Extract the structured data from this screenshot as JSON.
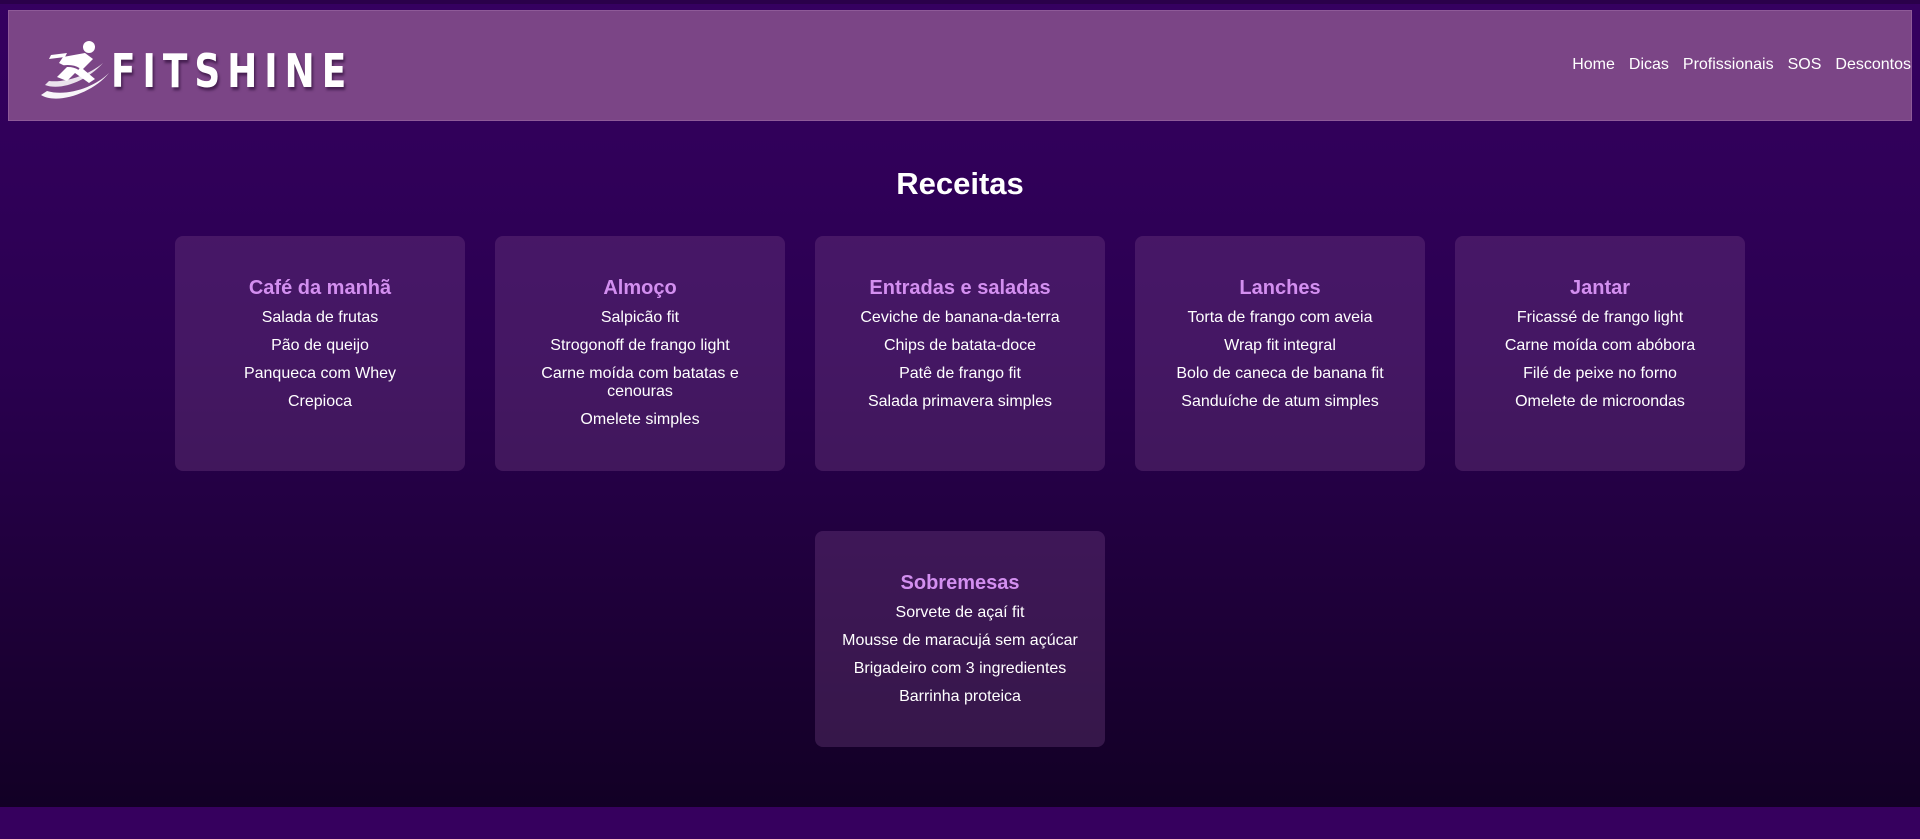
{
  "brand": {
    "name": "FITSHINE",
    "logo_icon": "running-figure-icon"
  },
  "nav": [
    {
      "label": "Home"
    },
    {
      "label": "Dicas"
    },
    {
      "label": "Profissionais"
    },
    {
      "label": "SOS"
    },
    {
      "label": "Descontos"
    }
  ],
  "section_title": "Receitas",
  "categories": [
    {
      "title": "Café da manhã",
      "items": [
        "Salada de frutas",
        "Pão de queijo",
        "Panqueca com Whey",
        "Crepioca"
      ]
    },
    {
      "title": "Almoço",
      "items": [
        "Salpicão fit",
        "Strogonoff de frango light",
        "Carne moída com batatas e cenouras",
        "Omelete simples"
      ]
    },
    {
      "title": "Entradas e saladas",
      "items": [
        "Ceviche de banana-da-terra",
        "Chips de batata-doce",
        "Patê de frango fit",
        "Salada primavera simples"
      ]
    },
    {
      "title": "Lanches",
      "items": [
        "Torta de frango com aveia",
        "Wrap fit integral",
        "Bolo de caneca de banana fit",
        "Sanduíche de atum simples"
      ]
    },
    {
      "title": "Jantar",
      "items": [
        "Fricassé de frango light",
        "Carne moída com abóbora",
        "Filé de peixe no forno",
        "Omelete de microondas"
      ]
    },
    {
      "title": "Sobremesas",
      "items": [
        "Sorvete de açaí fit",
        "Mousse de maracujá sem açúcar",
        "Brigadeiro com 3 ingredientes",
        "Barrinha proteica"
      ]
    }
  ],
  "colors": {
    "background": "#35005c",
    "header": "#7b4586",
    "card_title": "#d38ff0",
    "text": "#ffffff"
  }
}
